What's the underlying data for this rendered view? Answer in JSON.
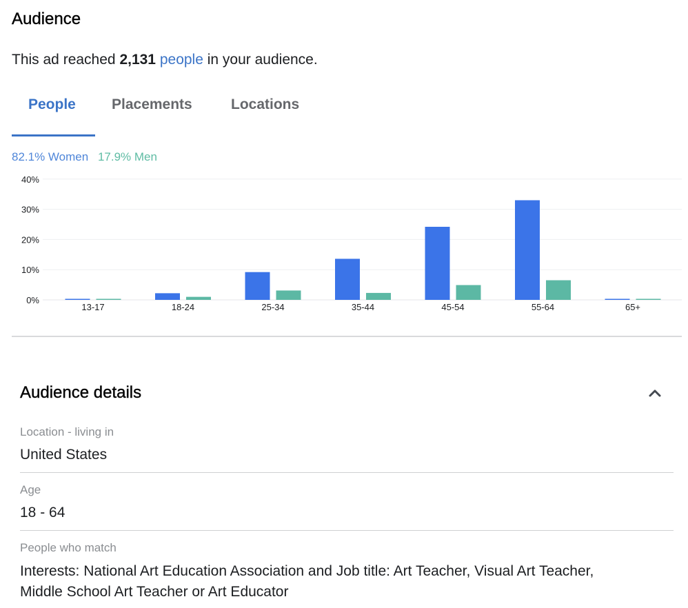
{
  "header": {
    "title": "Audience",
    "reach_prefix": "This ad reached",
    "reach_count": "2,131",
    "reach_link": "people",
    "reach_suffix": "in your audience."
  },
  "tabs": [
    {
      "label": "People",
      "active": true
    },
    {
      "label": "Placements",
      "active": false
    },
    {
      "label": "Locations",
      "active": false
    }
  ],
  "gender_split": {
    "women": "82.1% Women",
    "men": "17.9% Men"
  },
  "colors": {
    "women": "#3b74e8",
    "men": "#5cb8a4",
    "accent": "#3b74c7"
  },
  "chart_data": {
    "type": "bar",
    "categories": [
      "13-17",
      "18-24",
      "25-34",
      "35-44",
      "45-54",
      "55-64",
      "65+"
    ],
    "series": [
      {
        "name": "Women",
        "values": [
          0.3,
          2.2,
          9.2,
          13.6,
          24.2,
          33.0,
          0.3
        ]
      },
      {
        "name": "Men",
        "values": [
          0.3,
          1.0,
          3.1,
          2.3,
          4.9,
          6.5,
          0.3
        ]
      }
    ],
    "yticks": [
      "0%",
      "10%",
      "20%",
      "30%",
      "40%"
    ],
    "ylim": [
      0,
      40
    ],
    "grid": true
  },
  "details": {
    "title": "Audience details",
    "fields": [
      {
        "label": "Location - living in",
        "value": "United States"
      },
      {
        "label": "Age",
        "value": "18 - 64"
      },
      {
        "label": "People who match",
        "value": "Interests: National Art Education Association and Job title: Art Teacher, Visual Art Teacher, Middle School Art Teacher or Art Educator"
      }
    ]
  }
}
